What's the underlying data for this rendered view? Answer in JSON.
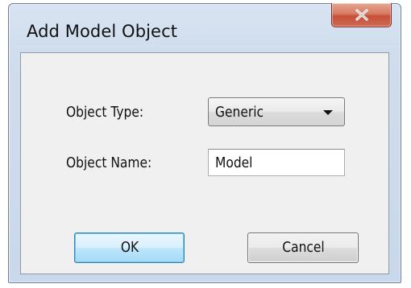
{
  "window": {
    "title": "Add Model Object"
  },
  "form": {
    "object_type_label": "Object Type:",
    "object_type_value": "Generic",
    "object_name_label": "Object Name:",
    "object_name_value": "Model"
  },
  "buttons": {
    "ok_label": "OK",
    "cancel_label": "Cancel"
  },
  "icons": {
    "close": "close-icon",
    "dropdown": "chevron-down-icon"
  },
  "colors": {
    "close_button": "#c6503a",
    "default_button_border": "#3c7fb1"
  }
}
